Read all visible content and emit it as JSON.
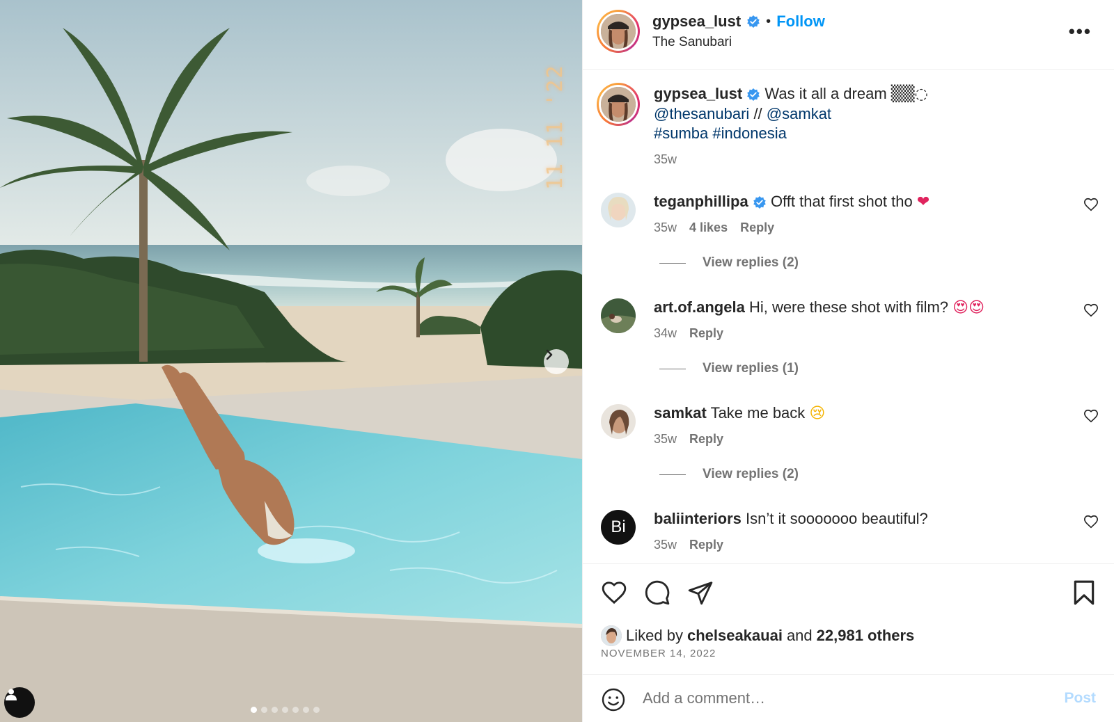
{
  "post": {
    "author": "gypsea_lust",
    "location": "The Sanubari",
    "follow_label": "Follow",
    "more_label": "•••",
    "film_date": "11 11 '22",
    "carousel_total": 7,
    "carousel_index": 1
  },
  "caption": {
    "author": "gypsea_lust",
    "text": "Was it all a dream",
    "emoji": "▒▒◌",
    "mention1": "@thesanubari",
    "sep": "//",
    "mention2": "@samkat",
    "tag1": "#sumba",
    "tag2": "#indonesia",
    "time": "35w"
  },
  "comments": [
    {
      "user": "teganphillipa",
      "verified": true,
      "text": "Offt that first shot tho",
      "emoji": "❤",
      "time": "35w",
      "likes": "4 likes",
      "reply": "Reply",
      "view_replies": "View replies (2)"
    },
    {
      "user": "art.of.angela",
      "verified": false,
      "text": "Hi, were these shot with film?",
      "emoji": "😍😍",
      "time": "34w",
      "likes": "",
      "reply": "Reply",
      "view_replies": "View replies (1)"
    },
    {
      "user": "samkat",
      "verified": false,
      "text": "Take me back",
      "emoji": "😢",
      "time": "35w",
      "likes": "",
      "reply": "Reply",
      "view_replies": "View replies (2)"
    },
    {
      "user": "baliinteriors",
      "verified": false,
      "text": "Isn’t it sooooooo beautiful?",
      "emoji": "",
      "time": "35w",
      "likes": "",
      "reply": "Reply",
      "view_replies": ""
    }
  ],
  "avatar_initials": {
    "baliinteriors": "Bi"
  },
  "engagement": {
    "liked_by_prefix": "Liked by",
    "liked_by_user": "chelseakauai",
    "and": "and",
    "others": "22,981 others",
    "date": "NOVEMBER 14, 2022"
  },
  "composer": {
    "placeholder": "Add a comment…",
    "post_label": "Post"
  },
  "icons": {
    "like": "heart-icon",
    "comment": "comment-bubble-icon",
    "share": "paper-plane-icon",
    "save": "bookmark-icon",
    "emoji": "smiley-icon",
    "next": "chevron-right-icon",
    "tag": "user-tag-icon",
    "verified": "verified-badge-icon"
  },
  "colors": {
    "accent": "#0095f6",
    "link": "#00376b",
    "muted": "#737373",
    "verified": "#3897f0",
    "post_disabled": "#b3dbff"
  }
}
